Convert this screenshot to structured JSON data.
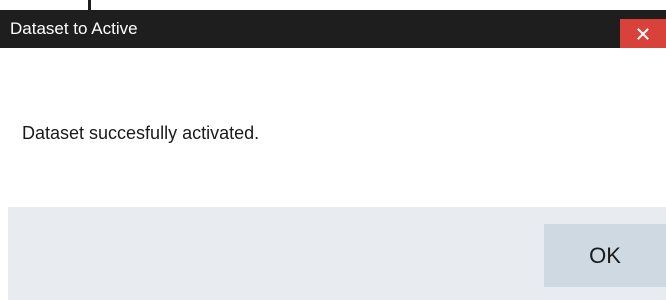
{
  "window": {
    "title": "Dataset to Active",
    "close_icon": "close-x-icon"
  },
  "dialog": {
    "message": "Dataset succesfully activated.",
    "ok_label": "OK"
  },
  "colors": {
    "titlebar": "#1e1e1e",
    "close_button": "#d9423a",
    "footer": "#e8ecf1",
    "ok_button": "#cfd9e2"
  }
}
